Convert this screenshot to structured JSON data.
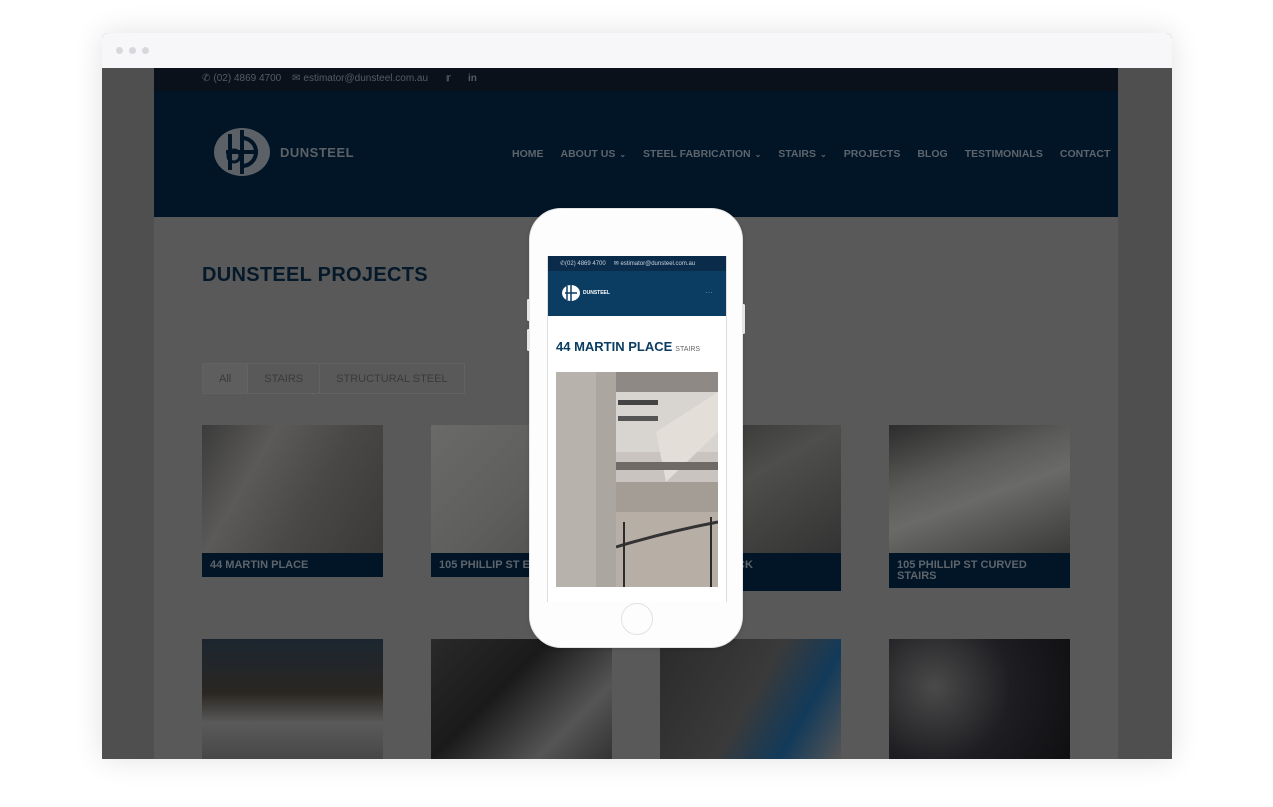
{
  "browser": {
    "window_controls": [
      "close",
      "minimize",
      "maximize"
    ]
  },
  "site": {
    "topbar": {
      "phone": "(02) 4869 4700",
      "email": "estimator@dunsteel.com.au",
      "social": [
        "twitter-icon",
        "linkedin-icon"
      ]
    },
    "logo_text": "DUNSTEEL",
    "nav": [
      {
        "label": "HOME",
        "dropdown": false
      },
      {
        "label": "ABOUT US",
        "dropdown": true
      },
      {
        "label": "STEEL FABRICATION",
        "dropdown": true
      },
      {
        "label": "STAIRS",
        "dropdown": true
      },
      {
        "label": "PROJECTS",
        "dropdown": false
      },
      {
        "label": "BLOG",
        "dropdown": false
      },
      {
        "label": "TESTIMONIALS",
        "dropdown": false
      },
      {
        "label": "CONTACT",
        "dropdown": false
      }
    ],
    "page_title": "DUNSTEEL PROJECTS",
    "filters": [
      {
        "label": "All",
        "active": true
      },
      {
        "label": "STAIRS",
        "active": false
      },
      {
        "label": "STRUCTURAL STEEL",
        "active": false
      }
    ],
    "projects": [
      {
        "caption": "44 MARTIN PLACE"
      },
      {
        "caption": "105 PHILLIP ST E"
      },
      {
        "caption": "T SWITCHBACK"
      },
      {
        "caption": "105 PHILLIP ST CURVED STAIRS"
      },
      {
        "caption": ""
      },
      {
        "caption": ""
      },
      {
        "caption": ""
      },
      {
        "caption": ""
      }
    ]
  },
  "mobile": {
    "phone": "(02) 4869 4700",
    "email": "estimator@dunsteel.com.au",
    "logo_text": "DUNSTEEL",
    "menu_icon": "menu-icon",
    "title": "44 MARTIN PLACE",
    "category": "STAIRS"
  },
  "colors": {
    "header_navy": "#011526",
    "mobile_navy": "#0b3d63",
    "overlay_grey": "#595959"
  }
}
